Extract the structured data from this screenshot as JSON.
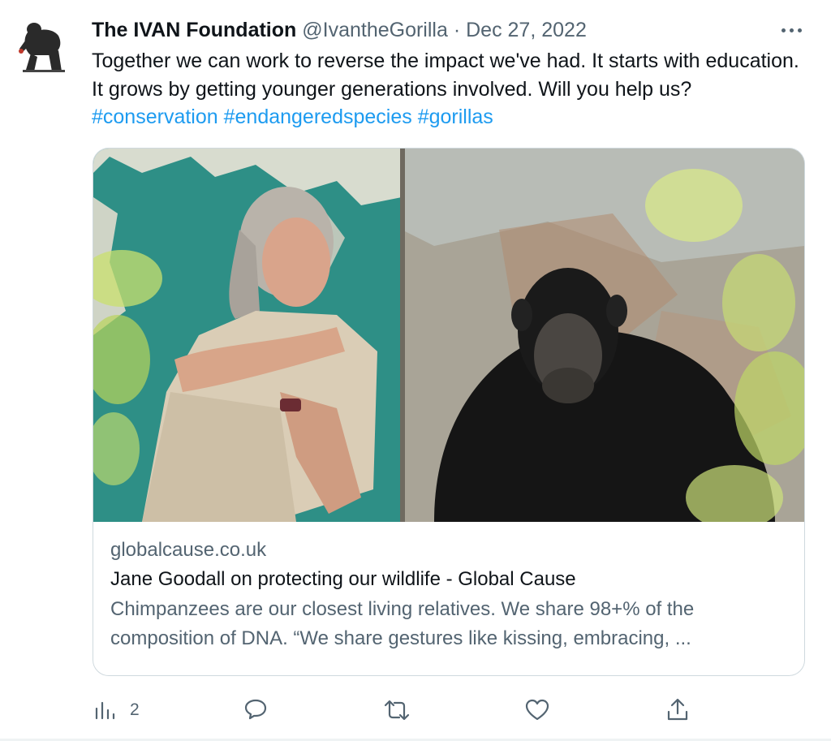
{
  "tweet": {
    "author_name": "The IVAN Foundation",
    "handle": "@IvantheGorilla",
    "separator": "·",
    "date": "Dec 27, 2022",
    "text": "Together we can work to reverse the impact we've had. It starts with education. It grows by getting younger generations involved. Will you help us?",
    "hashtags": [
      "#conservation",
      "#endangeredspecies",
      "#gorillas"
    ],
    "more_icon": "more-horizontal-icon"
  },
  "card": {
    "domain": "globalcause.co.uk",
    "title": "Jane Goodall on protecting our wildlife - Global Cause",
    "description_line1": "Chimpanzees are our closest living relatives. We share 98+% of the",
    "description_line2": "composition of DNA. “We share gestures like kissing, embracing, ...",
    "image_subject": "woman-with-chimpanzee-photo"
  },
  "actions": {
    "views_count": "2",
    "icons": [
      "analytics-icon",
      "reply-icon",
      "retweet-icon",
      "like-icon",
      "share-icon"
    ]
  },
  "colors": {
    "text_primary": "#0f1419",
    "text_secondary": "#536471",
    "link": "#1d9bf0",
    "border": "#cfd9de"
  }
}
